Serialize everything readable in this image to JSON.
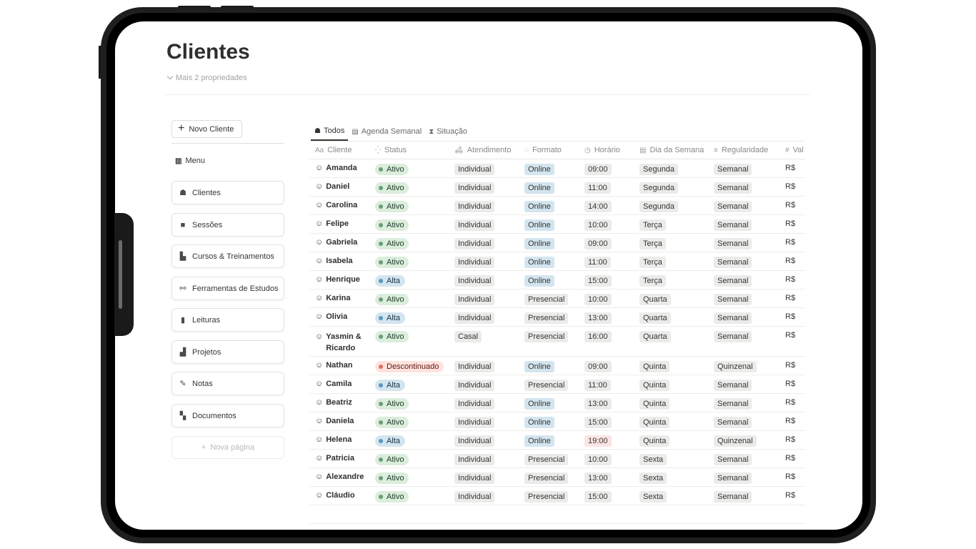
{
  "page": {
    "title": "Clientes",
    "more_properties": "Mais 2 propriedades"
  },
  "sidebar": {
    "new_button": "Novo Cliente",
    "menu_label": "Menu",
    "items": [
      {
        "label": "Clientes",
        "icon": "people-icon"
      },
      {
        "label": "Sessões",
        "icon": "briefcase-icon"
      },
      {
        "label": "Cursos & Treinamentos",
        "icon": "certificate-icon"
      },
      {
        "label": "Ferramentas de Estudos",
        "icon": "link-icon"
      },
      {
        "label": "Leituras",
        "icon": "book-icon"
      },
      {
        "label": "Projetos",
        "icon": "chart-icon"
      },
      {
        "label": "Notas",
        "icon": "edit-icon"
      },
      {
        "label": "Documentos",
        "icon": "document-icon"
      }
    ],
    "new_page": "Nova página"
  },
  "tabs": [
    {
      "label": "Todos",
      "active": true
    },
    {
      "label": "Agenda Semanal",
      "active": false
    },
    {
      "label": "Situação",
      "active": false
    }
  ],
  "table": {
    "columns": [
      "Cliente",
      "Status",
      "Atendimento",
      "Formato",
      "Horário",
      "Dia da Semana",
      "Regularidade",
      "Val"
    ],
    "column_icon_glyphs": [
      "Aa",
      "⁛",
      "🛋",
      "◌",
      "◷",
      "▤",
      "≡",
      "#"
    ],
    "rows": [
      {
        "cliente": "Amanda",
        "status": "Ativo",
        "status_color": "green",
        "atendimento": "Individual",
        "formato": "Online",
        "horario": "09:00",
        "dia": "Segunda",
        "regularidade": "Semanal",
        "valor": "R$"
      },
      {
        "cliente": "Daniel",
        "status": "Ativo",
        "status_color": "green",
        "atendimento": "Individual",
        "formato": "Online",
        "horario": "11:00",
        "dia": "Segunda",
        "regularidade": "Semanal",
        "valor": "R$"
      },
      {
        "cliente": "Carolina",
        "status": "Ativo",
        "status_color": "green",
        "atendimento": "Individual",
        "formato": "Online",
        "horario": "14:00",
        "dia": "Segunda",
        "regularidade": "Semanal",
        "valor": "R$"
      },
      {
        "cliente": "Felipe",
        "status": "Ativo",
        "status_color": "green",
        "atendimento": "Individual",
        "formato": "Online",
        "horario": "10:00",
        "dia": "Terça",
        "regularidade": "Semanal",
        "valor": "R$"
      },
      {
        "cliente": "Gabriela",
        "status": "Ativo",
        "status_color": "green",
        "atendimento": "Individual",
        "formato": "Online",
        "horario": "09:00",
        "dia": "Terça",
        "regularidade": "Semanal",
        "valor": "R$"
      },
      {
        "cliente": "Isabela",
        "status": "Ativo",
        "status_color": "green",
        "atendimento": "Individual",
        "formato": "Online",
        "horario": "11:00",
        "dia": "Terça",
        "regularidade": "Semanal",
        "valor": "R$"
      },
      {
        "cliente": "Henrique",
        "status": "Alta",
        "status_color": "blue",
        "atendimento": "Individual",
        "formato": "Online",
        "horario": "15:00",
        "dia": "Terça",
        "regularidade": "Semanal",
        "valor": "R$"
      },
      {
        "cliente": "Karina",
        "status": "Ativo",
        "status_color": "green",
        "atendimento": "Individual",
        "formato": "Presencial",
        "horario": "10:00",
        "dia": "Quarta",
        "regularidade": "Semanal",
        "valor": "R$"
      },
      {
        "cliente": "Olivia",
        "status": "Alta",
        "status_color": "blue",
        "atendimento": "Individual",
        "formato": "Presencial",
        "horario": "13:00",
        "dia": "Quarta",
        "regularidade": "Semanal",
        "valor": "R$"
      },
      {
        "cliente": "Yasmin & Ricardo",
        "status": "Ativo",
        "status_color": "green",
        "atendimento": "Casal",
        "formato": "Presencial",
        "horario": "16:00",
        "dia": "Quarta",
        "regularidade": "Semanal",
        "valor": "R$"
      },
      {
        "cliente": "Nathan",
        "status": "Descontinuado",
        "status_color": "red",
        "atendimento": "Individual",
        "formato": "Online",
        "horario": "09:00",
        "dia": "Quinta",
        "regularidade": "Quinzenal",
        "valor": "R$"
      },
      {
        "cliente": "Camila",
        "status": "Alta",
        "status_color": "blue",
        "atendimento": "Individual",
        "formato": "Presencial",
        "horario": "11:00",
        "dia": "Quinta",
        "regularidade": "Semanal",
        "valor": "R$"
      },
      {
        "cliente": "Beatriz",
        "status": "Ativo",
        "status_color": "green",
        "atendimento": "Individual",
        "formato": "Online",
        "horario": "13:00",
        "dia": "Quinta",
        "regularidade": "Semanal",
        "valor": "R$"
      },
      {
        "cliente": "Daniela",
        "status": "Ativo",
        "status_color": "green",
        "atendimento": "Individual",
        "formato": "Online",
        "horario": "15:00",
        "dia": "Quinta",
        "regularidade": "Semanal",
        "valor": "R$"
      },
      {
        "cliente": "Helena",
        "status": "Alta",
        "status_color": "blue",
        "atendimento": "Individual",
        "formato": "Online",
        "horario": "19:00",
        "horario_highlight": true,
        "dia": "Quinta",
        "regularidade": "Quinzenal",
        "valor": "R$"
      },
      {
        "cliente": "Patricia",
        "status": "Ativo",
        "status_color": "green",
        "atendimento": "Individual",
        "formato": "Presencial",
        "horario": "10:00",
        "dia": "Sexta",
        "regularidade": "Semanal",
        "valor": "R$"
      },
      {
        "cliente": "Alexandre",
        "status": "Ativo",
        "status_color": "green",
        "atendimento": "Individual",
        "formato": "Presencial",
        "horario": "13:00",
        "dia": "Sexta",
        "regularidade": "Semanal",
        "valor": "R$"
      },
      {
        "cliente": "Cláudio",
        "status": "Ativo",
        "status_color": "green",
        "atendimento": "Individual",
        "formato": "Presencial",
        "horario": "15:00",
        "dia": "Sexta",
        "regularidade": "Semanal",
        "valor": "R$"
      }
    ]
  }
}
